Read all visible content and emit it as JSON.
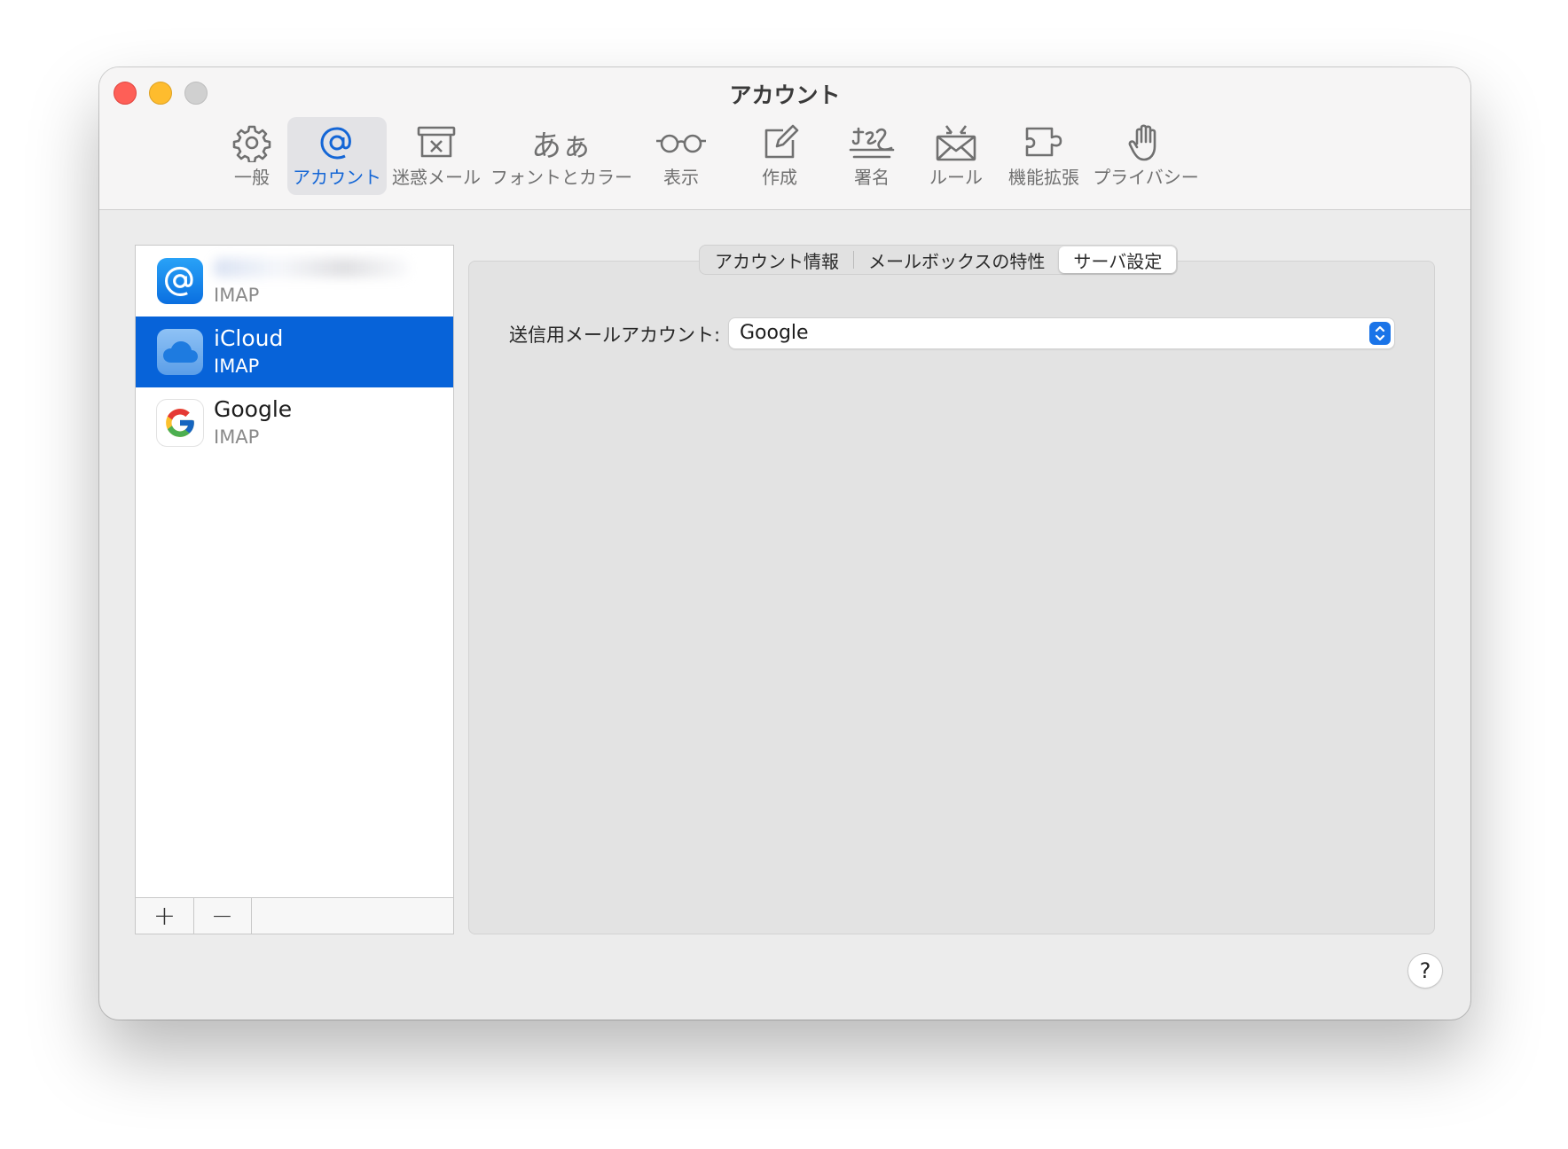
{
  "window": {
    "title": "アカウント"
  },
  "toolbar": {
    "items": [
      {
        "label": "一般",
        "icon": "gear-icon"
      },
      {
        "label": "アカウント",
        "icon": "at-icon",
        "selected": true
      },
      {
        "label": "迷惑メール",
        "icon": "junk-mail-icon"
      },
      {
        "label": "フォントとカラー",
        "icon": "font-icon",
        "glyph": "あぁ"
      },
      {
        "label": "表示",
        "icon": "glasses-icon"
      },
      {
        "label": "作成",
        "icon": "compose-icon"
      },
      {
        "label": "署名",
        "icon": "signature-icon"
      },
      {
        "label": "ルール",
        "icon": "rules-envelope-icon"
      },
      {
        "label": "機能拡張",
        "icon": "extension-puzzle-icon"
      },
      {
        "label": "プライバシー",
        "icon": "hand-icon"
      }
    ]
  },
  "sidebar": {
    "accounts": [
      {
        "name": "",
        "type": "IMAP",
        "icon": "at-account-icon",
        "name_blurred": true
      },
      {
        "name": "iCloud",
        "type": "IMAP",
        "icon": "icloud-icon",
        "selected": true
      },
      {
        "name": "Google",
        "type": "IMAP",
        "icon": "google-icon"
      }
    ],
    "add_label": "+",
    "remove_label": "−"
  },
  "tabs": [
    {
      "label": "アカウント情報"
    },
    {
      "label": "メールボックスの特性"
    },
    {
      "label": "サーバ設定",
      "selected": true
    }
  ],
  "server_settings": {
    "outgoing_label": "送信用メールアカウント:",
    "outgoing_value": "Google"
  },
  "help_label": "?",
  "colors": {
    "accent": "#0763d9",
    "selected_toolbar_text": "#1466d6",
    "close": "#fe5f57",
    "minimize": "#febc2e",
    "zoom_inactive": "#d0d0d0"
  }
}
